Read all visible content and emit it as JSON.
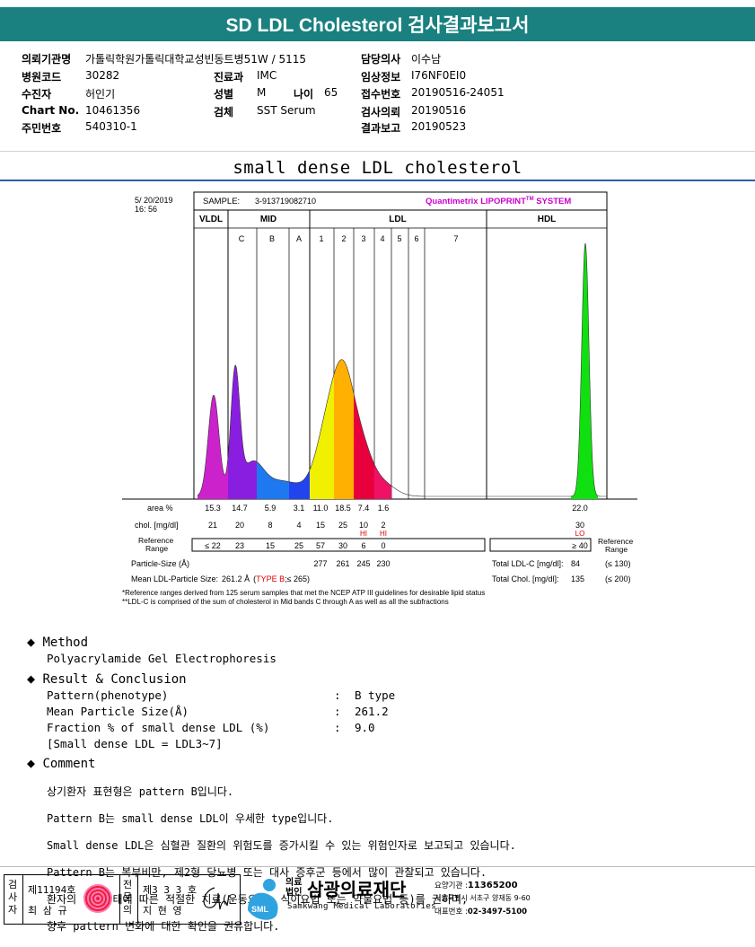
{
  "header": {
    "title": "SD LDL Cholesterol 검사결과보고서"
  },
  "patient": {
    "institution_label": "의뢰기관명",
    "institution": "가톨릭학원가톨릭대학교성빈동트병51W / 5115",
    "hospital_code_label": "병원코드",
    "hospital_code": "30282",
    "patient_label": "수진자",
    "patient_name": "허인기",
    "chart_label": "Chart No.",
    "chart_no": "10461356",
    "rrn_label": "주민번호",
    "rrn": "540310-1",
    "dept_label": "진료과",
    "dept": "IMC",
    "sex_label": "성별",
    "sex": "M",
    "age_label": "나이",
    "age": "65",
    "specimen_label": "검체",
    "specimen": "SST Serum",
    "doctor_label": "담당의사",
    "doctor": "이수남",
    "clinical_label": "임상정보",
    "clinical": "I76NF0EI0",
    "accession_label": "접수번호",
    "accession": "20190516-24051",
    "request_label": "검사의뢰",
    "request_date": "20190516",
    "report_label": "결과보고",
    "report_date": "20190523"
  },
  "graph_title": "small dense LDL cholesterol",
  "chart_data": {
    "type": "area",
    "print_date": "5/ 20/2019",
    "print_time": "16: 56",
    "sample_label": "SAMPLE:",
    "sample_id": "3-913719082710",
    "brand": "Quantimetrix LIPOPRINT",
    "brand_tm": "TM",
    "brand_suffix": " SYSTEM",
    "band_groups": [
      "VLDL",
      "MID",
      "LDL",
      "HDL"
    ],
    "mid_bands": [
      "C",
      "B",
      "A"
    ],
    "ldl_bands": [
      "1",
      "2",
      "3",
      "4",
      "5",
      "6",
      "7"
    ],
    "row_labels": {
      "area": "area %",
      "chol": "chol. [mg/dl]",
      "ref": "Reference\nRange",
      "ref_right": "Reference\nRange",
      "particle": "Particle-Size (Å)",
      "mean": "Mean LDL-Particle Size:"
    },
    "fractions": [
      "VLDL",
      "MID C",
      "MID B",
      "MID A",
      "LDL1",
      "LDL2",
      "LDL3",
      "LDL4"
    ],
    "area_pct": [
      "15.3",
      "14.7",
      "5.9",
      "3.1",
      "11.0",
      "18.5",
      "7.4",
      "1.6"
    ],
    "chol_mgdl": [
      "21",
      "20",
      "8",
      "4",
      "15",
      "25",
      "10",
      "2"
    ],
    "flags": {
      "LDL3": "HI",
      "LDL4": "HI",
      "HDL": "LO"
    },
    "reference_range": [
      "≤ 22",
      "23",
      "15",
      "25",
      "57",
      "30",
      "6",
      "0"
    ],
    "particle_size": [
      "277",
      "261",
      "245",
      "230"
    ],
    "hdl_area_pct": "22.0",
    "hdl_chol": "30",
    "hdl_ref": "≥ 40",
    "mean_ldl_size": "261.2 Å",
    "type_text": "TYPE B",
    "type_suffix": ";≤ 265)",
    "total_ldl_label": "Total LDL-C [mg/dl]:",
    "total_ldl": "84",
    "total_ldl_ref": "(≤ 130)",
    "total_chol_label": "Total Chol. [mg/dl]:",
    "total_chol": "135",
    "total_chol_ref": "(≤ 200)",
    "peaks": [
      {
        "fraction": "VLDL",
        "height": 0.4
      },
      {
        "fraction": "MID C",
        "height": 0.48
      },
      {
        "fraction": "LDL2",
        "height": 0.51
      },
      {
        "fraction": "HDL",
        "height": 1.0
      }
    ],
    "footnote1": "*Reference ranges derived from 125 serum samples that met the NCEP ATP III guidelines for desirable lipid status",
    "footnote2": "**LDL-C is comprised of the sum of cholesterol in Mid bands C through A as well as all the subfractions",
    "colors": {
      "VLDL": "#cc22cc",
      "MID C": "#8a1ee0",
      "MID B": "#1e78f0",
      "MID A": "#2244ee",
      "LDL1": "#f0f000",
      "LDL2": "#ffb000",
      "LDL3": "#e8003c",
      "LDL4": "#ee1166",
      "HDL": "#10e010",
      "brand": "#cc00cc",
      "flag": "#e00000"
    }
  },
  "method": {
    "heading": "Method",
    "text": "Polyacrylamide Gel Electrophoresis"
  },
  "result": {
    "heading": "Result & Conclusion",
    "rows": [
      {
        "label": "Pattern(phenotype)",
        "value": "B type"
      },
      {
        "label": "Mean Particle Size(Å)",
        "value": "261.2"
      },
      {
        "label": "Fraction % of small dense LDL (%)",
        "value": "9.0"
      }
    ],
    "note": "[Small dense LDL = LDL3~7]"
  },
  "comment": {
    "heading": "Comment",
    "lines": [
      "상기환자 표현형은 pattern B입니다.",
      "Pattern B는 small dense LDL이 우세한 type입니다.",
      "Small dense LDL은 심혈관 질환의 위험도를 증가시킬 수 있는 위험인자로 보고되고 있습니다.",
      "Pattern B는 복부비만, 제2형 당뇨병 또는 대사 증후군 등에서 많이 관찰되고 있습니다.",
      "환자의 임상상태에 따른 적절한 치료(운동요법, 식이요법 또는 약물요법 등)를 권하며,",
      "향후 pattern 변화에 대한 확인을 권유합니다."
    ]
  },
  "footer": {
    "examiner_label": "검사자",
    "examiner_no": "제11194호",
    "examiner_name": "최 삼 규",
    "specialist_label": "전문의",
    "specialist_no": "제3 3 3 호",
    "specialist_name": "지 현 영",
    "org_type": "의료\n법인",
    "org_name": "삼광의료재단",
    "org_english": "Samkwang Medical Laboratories",
    "sml": "SML",
    "code_label": "요양기관 :",
    "code": "11365200",
    "address": "서울특별시 서초구 양재동 9-60",
    "phone_label": "대표번호 :",
    "phone": "02-3497-5100"
  }
}
